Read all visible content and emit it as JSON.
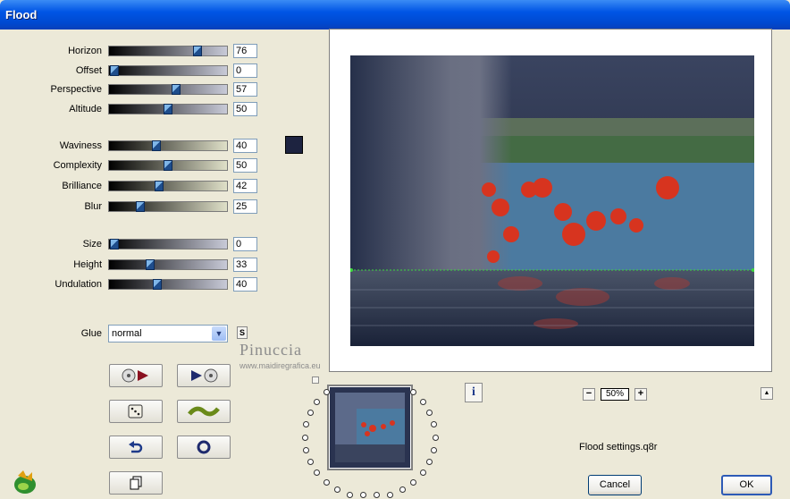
{
  "window": {
    "title": "Flood"
  },
  "controls": {
    "horizon": {
      "label": "Horizon",
      "value": "76",
      "level": 76
    },
    "offset": {
      "label": "Offset",
      "value": "0",
      "level": 0
    },
    "perspective": {
      "label": "Perspective",
      "value": "57",
      "level": 57
    },
    "altitude": {
      "label": "Altitude",
      "value": "50",
      "level": 50
    },
    "waviness": {
      "label": "Waviness",
      "value": "40",
      "level": 40
    },
    "complexity": {
      "label": "Complexity",
      "value": "50",
      "level": 50
    },
    "brilliance": {
      "label": "Brilliance",
      "value": "42",
      "level": 42
    },
    "blur": {
      "label": "Blur",
      "value": "25",
      "level": 25
    },
    "size": {
      "label": "Size",
      "value": "0",
      "level": 0
    },
    "height": {
      "label": "Height",
      "value": "33",
      "level": 33
    },
    "undulation": {
      "label": "Undulation",
      "value": "40",
      "level": 40
    }
  },
  "color_swatch": "#1d2340",
  "glue": {
    "label": "Glue",
    "value": "normal",
    "s_button": "S"
  },
  "watermark": {
    "name": "Pinuccia",
    "site": "www.maidiregrafica.eu"
  },
  "zoom": {
    "value": "50%",
    "minus": "−",
    "plus": "+"
  },
  "settings_file": "Flood settings.q8r",
  "buttons": {
    "cancel": "Cancel",
    "ok": "OK",
    "info": "i",
    "up": "▲"
  }
}
